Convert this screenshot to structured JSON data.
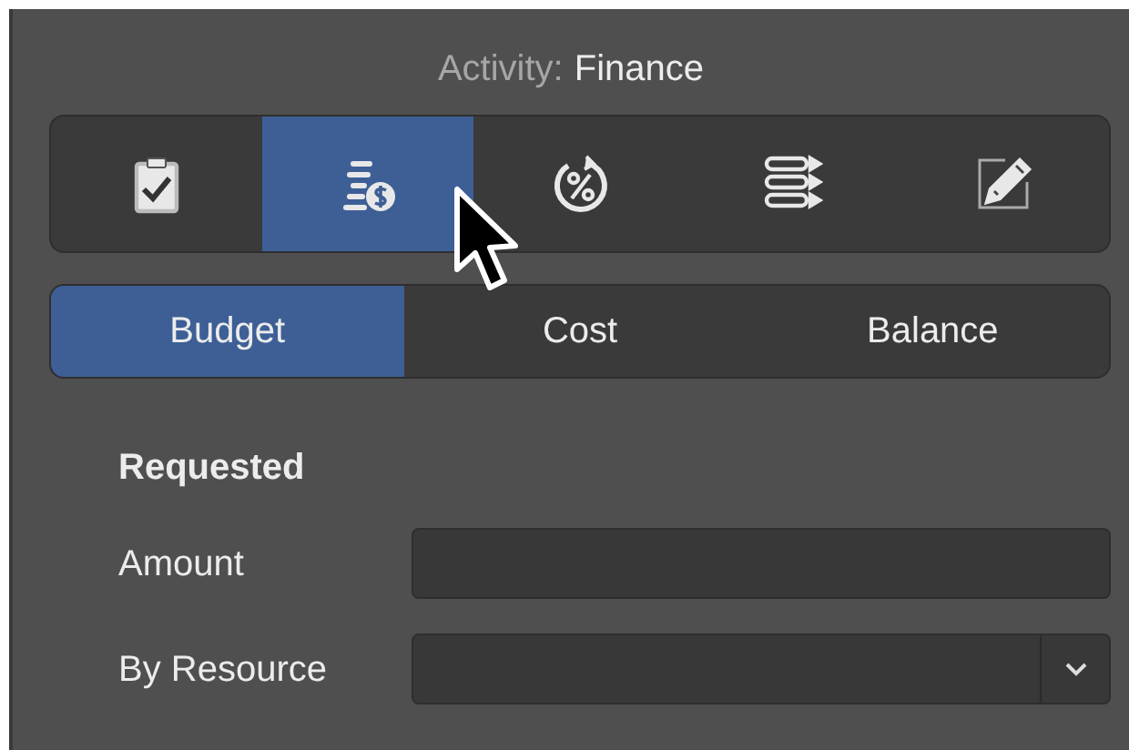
{
  "header": {
    "label": "Activity:",
    "value": "Finance"
  },
  "icon_tabs": [
    {
      "kind": "clipboard",
      "selected": false
    },
    {
      "kind": "coins",
      "selected": true
    },
    {
      "kind": "percent",
      "selected": false
    },
    {
      "kind": "list",
      "selected": false
    },
    {
      "kind": "edit",
      "selected": false
    }
  ],
  "segments": [
    {
      "label": "Budget",
      "selected": true
    },
    {
      "label": "Cost",
      "selected": false
    },
    {
      "label": "Balance",
      "selected": false
    }
  ],
  "section": "Requested",
  "fields": [
    {
      "label": "Amount",
      "kind": "text"
    },
    {
      "label": "By Resource",
      "kind": "dropdown"
    }
  ]
}
